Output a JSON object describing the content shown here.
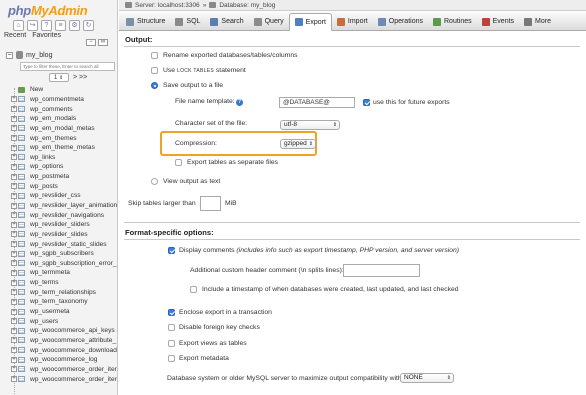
{
  "nav": {
    "logo_part1": "php",
    "logo_part2": "MyAdmin",
    "tabs": [
      "Recent",
      "Favorites"
    ],
    "db_name": "my_blog",
    "filter_placeholder": "Type to filter these, Enter to search all",
    "page_number": "1",
    "next_label": "> >>",
    "new_label": "New",
    "tables": [
      "wp_commentmeta",
      "wp_comments",
      "wp_em_modals",
      "wp_em_modal_metas",
      "wp_em_themes",
      "wp_em_theme_metas",
      "wp_links",
      "wp_options",
      "wp_postmeta",
      "wp_posts",
      "wp_revslider_css",
      "wp_revslider_layer_animation",
      "wp_revslider_navigations",
      "wp_revslider_sliders",
      "wp_revslider_slides",
      "wp_revslider_static_slides",
      "wp_sgpb_subscribers",
      "wp_sgpb_subscription_error_",
      "wp_termmeta",
      "wp_terms",
      "wp_term_relationships",
      "wp_term_taxonomy",
      "wp_usermeta",
      "wp_users",
      "wp_woocommerce_api_keys",
      "wp_woocommerce_attribute_",
      "wp_woocommerce_download",
      "wp_woocommerce_log",
      "wp_woocommerce_order_iter",
      "wp_woocommerce_order_iter"
    ]
  },
  "breadcrumb": {
    "server": "Server: localhost:3306",
    "separator": "»",
    "database": "Database: my_blog"
  },
  "tabs": [
    {
      "label": "Structure",
      "color": "#7a8fa8"
    },
    {
      "label": "SQL",
      "color": "#8a8a8a"
    },
    {
      "label": "Search",
      "color": "#5c7fb0"
    },
    {
      "label": "Query",
      "color": "#8c8c8c"
    },
    {
      "label": "Export",
      "color": "#4f7fc5"
    },
    {
      "label": "Import",
      "color": "#c76d3b"
    },
    {
      "label": "Operations",
      "color": "#6e8bb5"
    },
    {
      "label": "Routines",
      "color": "#5f9a4a"
    },
    {
      "label": "Events",
      "color": "#c0403a"
    },
    {
      "label": "More",
      "color": "#777777"
    }
  ],
  "output": {
    "title": "Output:",
    "rename_label": "Rename exported databases/tables/columns",
    "use_label_pre": "Use",
    "use_label_sc": "LOCK TABLES",
    "use_label_post": "statement",
    "save_label": "Save output to a file",
    "filename_label": "File name template:",
    "filename_value": "@DATABASE@",
    "future_label": "use this for future exports",
    "charset_label": "Character set of the file:",
    "charset_value": "utf-8",
    "compression_label": "Compression:",
    "compression_value": "gzipped",
    "separate_label": "Export tables as separate files",
    "view_label": "View output as text",
    "skip_label": "Skip tables larger than",
    "skip_value": "",
    "skip_unit": "MiB"
  },
  "format": {
    "title": "Format-specific options:",
    "display_comments_label": "Display comments",
    "display_comments_hint": "(includes info such as export timestamp, PHP version, and server version)",
    "custom_header_label": "Additional custom header comment (\\n splits lines):",
    "custom_header_value": "",
    "timestamp_label": "Include a timestamp of when databases were created, last updated, and last checked",
    "transaction_label": "Enclose export in a transaction",
    "fk_label": "Disable foreign key checks",
    "views_label": "Export views as tables",
    "metadata_label": "Export metadata",
    "compat_label": "Database system or older MySQL server to maximize output compatibility with:",
    "compat_value": "NONE"
  }
}
